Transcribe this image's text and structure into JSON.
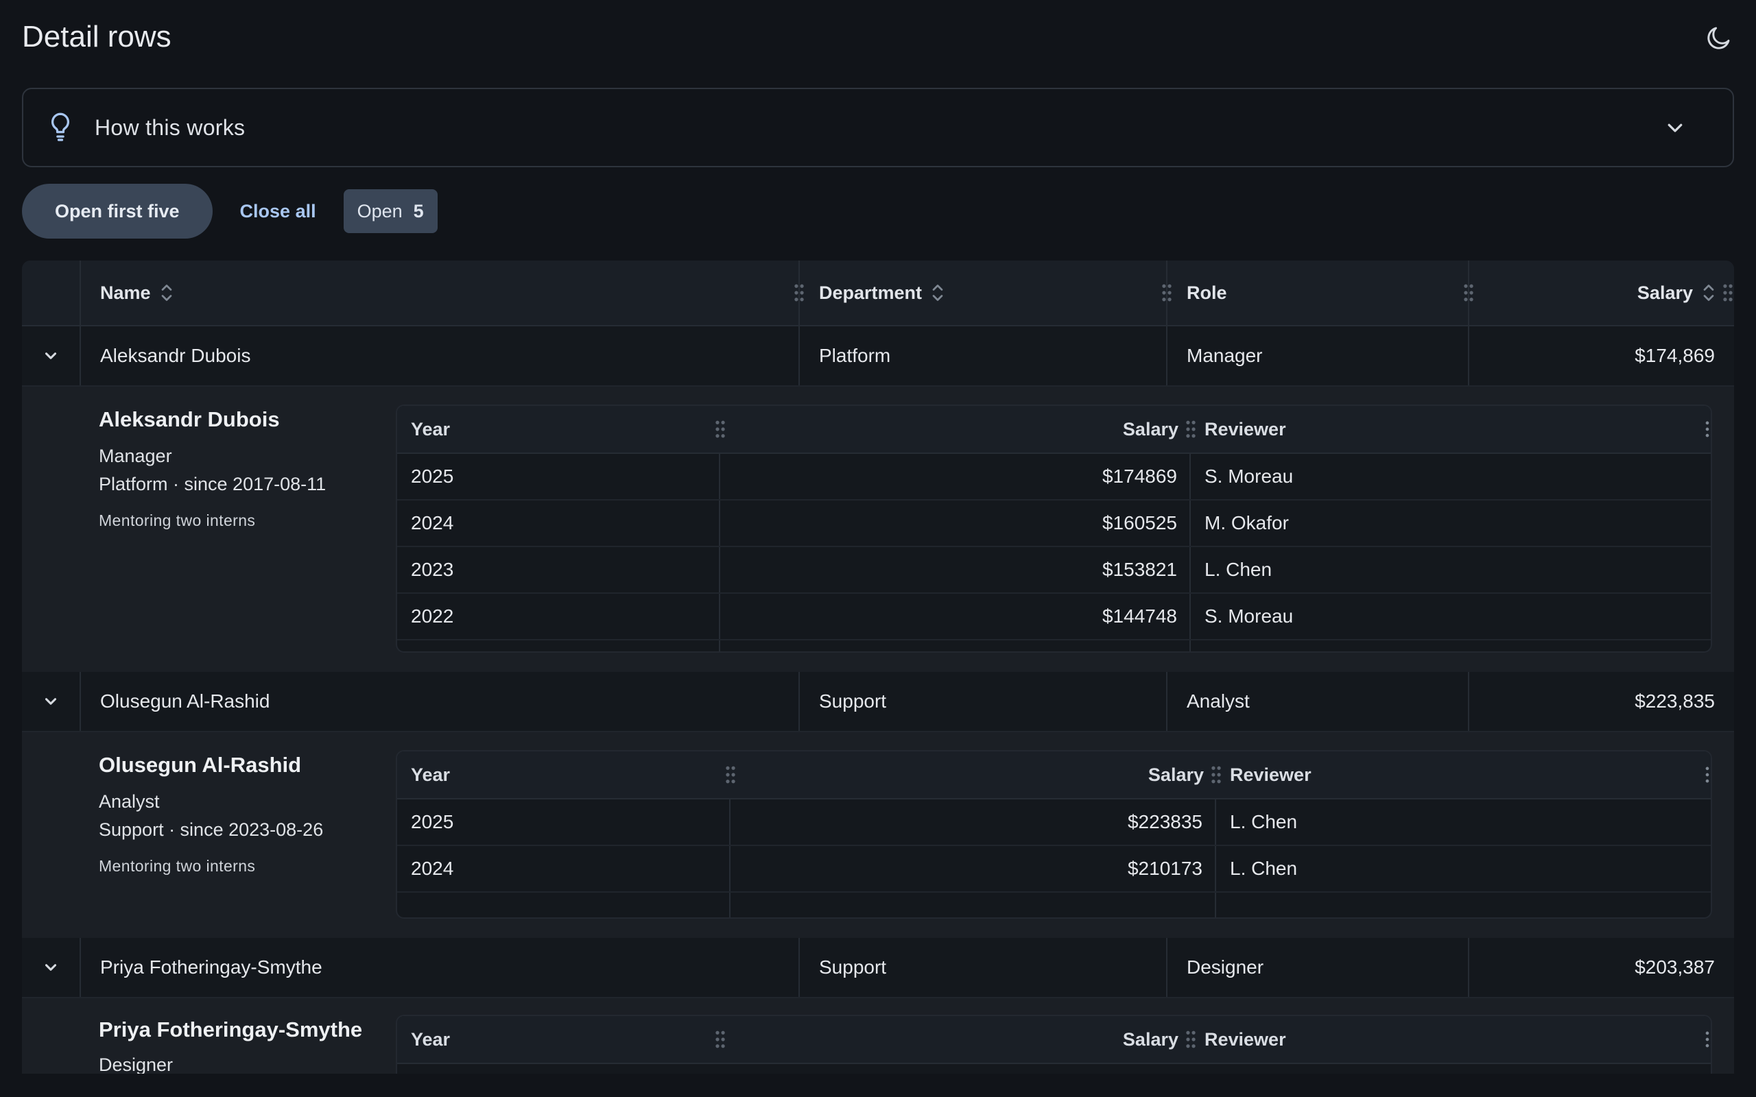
{
  "page": {
    "title": "Detail rows"
  },
  "help": {
    "label": "How this works"
  },
  "actions": {
    "open_first_five": "Open first five",
    "close_all": "Close all",
    "open_label": "Open",
    "open_count": "5"
  },
  "columns": {
    "name": "Name",
    "department": "Department",
    "role": "Role",
    "salary": "Salary"
  },
  "sub_columns": {
    "year": "Year",
    "salary": "Salary",
    "reviewer": "Reviewer"
  },
  "rows": [
    {
      "name": "Aleksandr Dubois",
      "department": "Platform",
      "role": "Manager",
      "salary": "$174,869",
      "detail": {
        "name": "Aleksandr Dubois",
        "role": "Manager",
        "meta": "Platform · since 2017-08-11",
        "note": "Mentoring two interns",
        "history": [
          {
            "year": "2025",
            "salary": "$174869",
            "reviewer": "S. Moreau"
          },
          {
            "year": "2024",
            "salary": "$160525",
            "reviewer": "M. Okafor"
          },
          {
            "year": "2023",
            "salary": "$153821",
            "reviewer": "L. Chen"
          },
          {
            "year": "2022",
            "salary": "$144748",
            "reviewer": "S. Moreau"
          }
        ]
      }
    },
    {
      "name": "Olusegun Al-Rashid",
      "department": "Support",
      "role": "Analyst",
      "salary": "$223,835",
      "detail": {
        "name": "Olusegun Al-Rashid",
        "role": "Analyst",
        "meta": "Support · since 2023-08-26",
        "note": "Mentoring two interns",
        "history": [
          {
            "year": "2025",
            "salary": "$223835",
            "reviewer": "L. Chen"
          },
          {
            "year": "2024",
            "salary": "$210173",
            "reviewer": "L. Chen"
          }
        ]
      }
    },
    {
      "name": "Priya Fotheringay-Smythe",
      "department": "Support",
      "role": "Designer",
      "salary": "$203,387",
      "detail": {
        "name": "Priya Fotheringay-Smythe",
        "role": "Designer"
      }
    }
  ],
  "colors": {
    "background": "#111419",
    "accent": "#a8c6f0",
    "button": "#3a4657"
  }
}
